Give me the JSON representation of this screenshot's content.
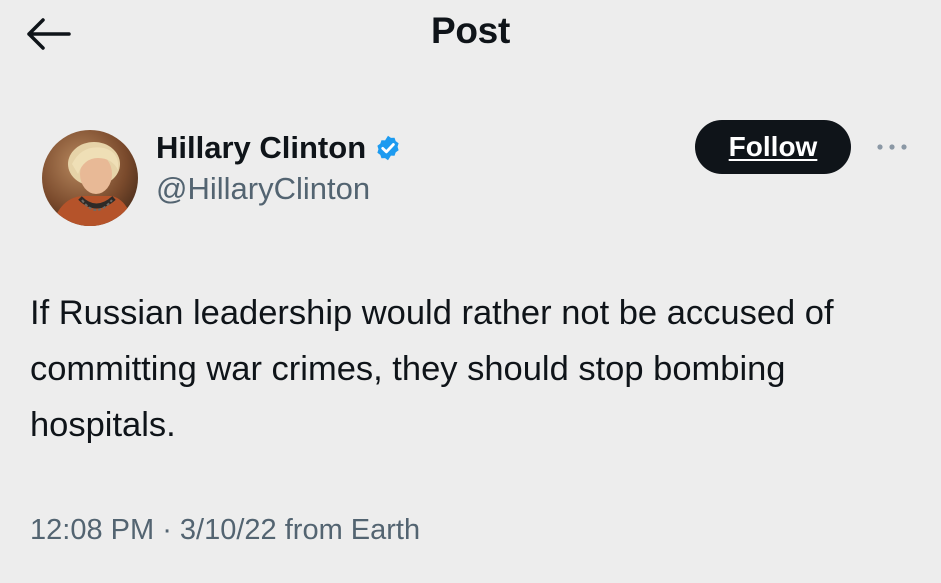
{
  "header": {
    "back_icon": "arrow-left-icon",
    "title": "Post"
  },
  "author": {
    "avatar_icon": "avatar",
    "name": "Hillary Clinton",
    "verified_icon": "verified-badge-icon",
    "verified_color": "#1d9bf0",
    "handle": "@HillaryClinton"
  },
  "actions": {
    "follow_label": "Follow",
    "more_icon": "more-horizontal-icon"
  },
  "tweet": {
    "text": "If Russian leadership would rather not be accused of committing war crimes, they should stop bombing hospitals."
  },
  "meta": {
    "time": "12:08 PM",
    "separator": " · ",
    "date": "3/10/22",
    "source": " from Earth"
  }
}
